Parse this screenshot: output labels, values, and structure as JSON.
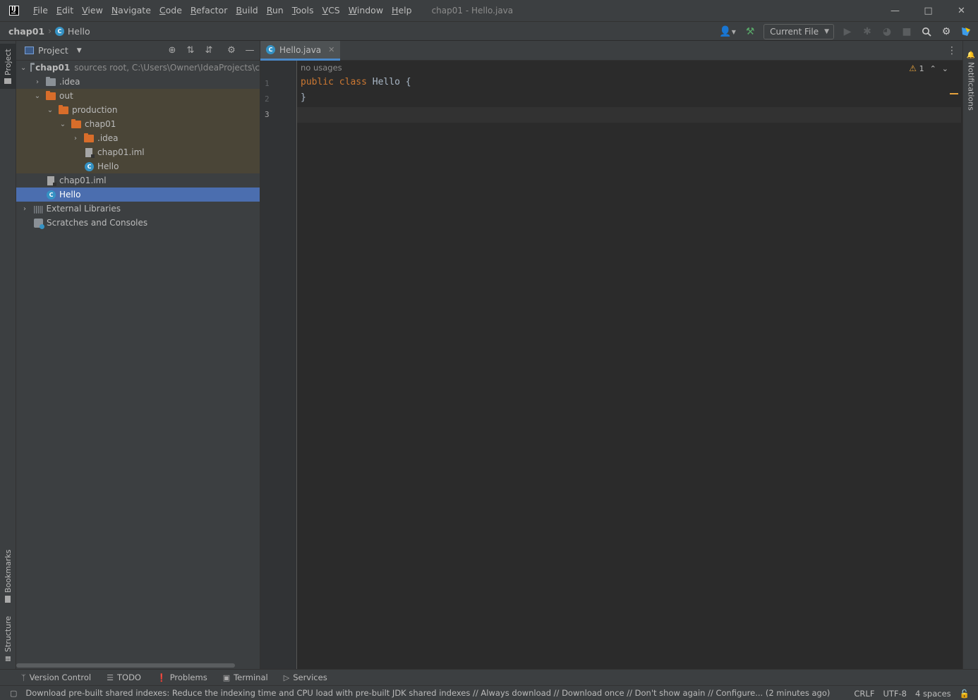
{
  "window": {
    "title": "chap01 - Hello.java",
    "logo_text": "IJ"
  },
  "menu": [
    {
      "label": "File",
      "mnemonic": "F",
      "rest": "ile"
    },
    {
      "label": "Edit",
      "mnemonic": "E",
      "rest": "dit"
    },
    {
      "label": "View",
      "mnemonic": "V",
      "rest": "iew"
    },
    {
      "label": "Navigate",
      "mnemonic": "N",
      "rest": "avigate"
    },
    {
      "label": "Code",
      "mnemonic": "C",
      "rest": "ode"
    },
    {
      "label": "Refactor",
      "mnemonic": "R",
      "rest": "efactor"
    },
    {
      "label": "Build",
      "mnemonic": "B",
      "rest": "uild"
    },
    {
      "label": "Run",
      "mnemonic": "R",
      "rest": "un"
    },
    {
      "label": "Tools",
      "mnemonic": "T",
      "rest": "ools"
    },
    {
      "label": "VCS",
      "mnemonic": "V",
      "rest": "CS"
    },
    {
      "label": "Window",
      "mnemonic": "W",
      "rest": "indow"
    },
    {
      "label": "Help",
      "mnemonic": "H",
      "rest": "elp"
    }
  ],
  "breadcrumb": {
    "root": "chap01",
    "file": "Hello",
    "file_icon": "C"
  },
  "toolbar": {
    "run_config": "Current File"
  },
  "left_stripe": {
    "project": "Project",
    "bookmarks": "Bookmarks",
    "structure": "Structure"
  },
  "right_stripe": {
    "notifications": "Notifications"
  },
  "project_panel": {
    "title": "Project",
    "tree": {
      "root_name": "chap01",
      "root_detail": "sources root,  C:\\Users\\Owner\\IdeaProjects\\c",
      "idea": ".idea",
      "out": "out",
      "production": "production",
      "prod_chap01": "chap01",
      "prod_idea": ".idea",
      "prod_iml": "chap01.iml",
      "prod_hello": "Hello",
      "iml": "chap01.iml",
      "hello": "Hello",
      "external_libraries": "External Libraries",
      "scratches": "Scratches and Consoles"
    }
  },
  "editor": {
    "tab_label": "Hello.java",
    "usage_hint": "no usages",
    "line_numbers": [
      "1",
      "2",
      "3"
    ],
    "code": {
      "kw_public": "public",
      "kw_class": "class",
      "class_name": "Hello",
      "open_brace": "{",
      "close_brace": "}"
    },
    "warning_count": "1"
  },
  "bottom_tabs": {
    "version_control": "Version Control",
    "todo": "TODO",
    "problems": "Problems",
    "terminal": "Terminal",
    "services": "Services"
  },
  "status": {
    "message": "Download pre-built shared indexes: Reduce the indexing time and CPU load with pre-built JDK shared indexes // Always download // Download once // Don't show again // Configure... (2 minutes ago)",
    "line_separator": "CRLF",
    "encoding": "UTF-8",
    "indent": "4 spaces"
  },
  "colors": {
    "background": "#2b2b2b",
    "panel": "#3c3f41",
    "selection": "#4b6eaf",
    "excluded": "#4a4537",
    "keyword": "#cc7832",
    "code_text": "#a9b7c6",
    "class_icon": "#3592c4",
    "folder_excluded": "#d86d2a",
    "warning": "#e6a23c"
  }
}
